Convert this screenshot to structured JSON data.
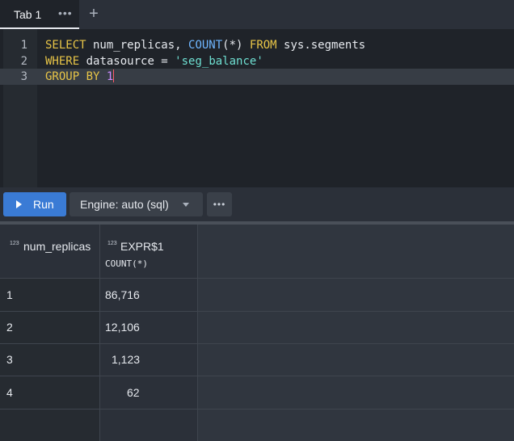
{
  "tabs": {
    "active_label": "Tab 1",
    "menu_glyph": "•••",
    "add_glyph": "+"
  },
  "editor": {
    "lines": [
      {
        "number": "1",
        "tokens": [
          {
            "t": "SELECT",
            "c": "kw"
          },
          {
            "t": " num_replicas, ",
            "c": "plain"
          },
          {
            "t": "COUNT",
            "c": "fn"
          },
          {
            "t": "(*) ",
            "c": "plain"
          },
          {
            "t": "FROM",
            "c": "kw"
          },
          {
            "t": " sys.segments",
            "c": "plain"
          }
        ]
      },
      {
        "number": "2",
        "tokens": [
          {
            "t": "WHERE",
            "c": "kw"
          },
          {
            "t": " datasource = ",
            "c": "plain"
          },
          {
            "t": "'seg_balance'",
            "c": "str"
          }
        ]
      },
      {
        "number": "3",
        "tokens": [
          {
            "t": "GROUP BY",
            "c": "kw"
          },
          {
            "t": " ",
            "c": "plain"
          },
          {
            "t": "1",
            "c": "num"
          }
        ]
      }
    ]
  },
  "toolbar": {
    "run_label": "Run",
    "engine_label": "Engine: auto (sql)",
    "more_glyph": "•••"
  },
  "results": {
    "columns": [
      {
        "type_badge": "123",
        "name": "num_replicas",
        "sub": ""
      },
      {
        "type_badge": "123",
        "name": "EXPR$1",
        "sub": "COUNT(*)"
      }
    ],
    "rows": [
      [
        "1",
        "86,716"
      ],
      [
        "2",
        "12,106"
      ],
      [
        "3",
        "1,123"
      ],
      [
        "4",
        "62"
      ]
    ]
  },
  "colors": {
    "accent": "#3a7bd5",
    "keyword": "#e8c547",
    "function": "#6fb6ff",
    "string": "#6fe0d2",
    "number": "#c98bff",
    "cursor": "#ff5b6b"
  }
}
